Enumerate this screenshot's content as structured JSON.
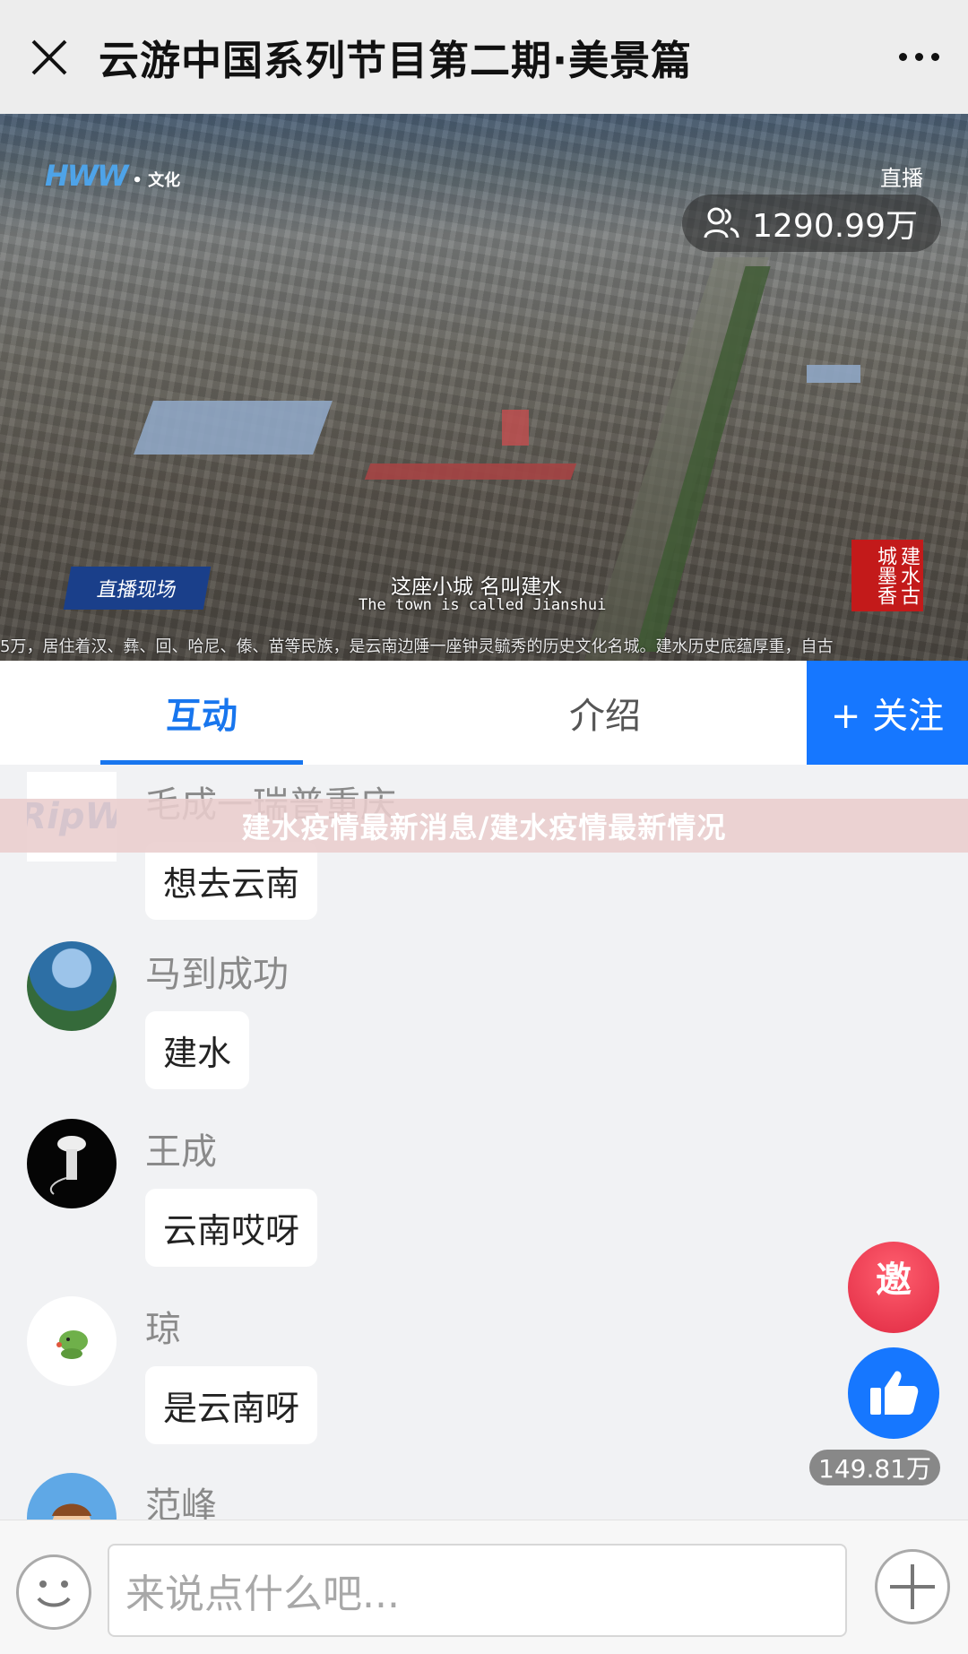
{
  "header": {
    "title": "云游中国系列节目第二期·美景篇",
    "close_icon": "close-icon",
    "more_icon": "more-dots-icon"
  },
  "video": {
    "logo_text": "HWW",
    "logo_sub": "• 文化",
    "live_label": "直播",
    "viewers": "1290.99万",
    "scene_badge": "直播现场",
    "subtitle_cn": "这座小城 名叫建水",
    "subtitle_en": "The town is called Jianshui",
    "ticker": "5万，居住着汉、彝、回、哈尼、傣、苗等民族，是云南边陲一座钟灵毓秀的历史文化名城。建水历史底蕴厚重，自古",
    "seal_text": "建水古城墨香"
  },
  "tabs": [
    {
      "label": "互动",
      "active": true
    },
    {
      "label": "介绍",
      "active": false
    }
  ],
  "follow_label": "+ 关注",
  "watermark": "建水疫情最新消息/建水疫情最新情况",
  "comments": [
    {
      "name": "毛成一瑞普重庆",
      "text": "想去云南",
      "avatar_text": "RipW"
    },
    {
      "name": "马到成功",
      "text": "建水"
    },
    {
      "name": "王成",
      "text": "云南哎呀"
    },
    {
      "name": "琼",
      "text": "是云南呀"
    },
    {
      "name": "范峰",
      "text": ""
    }
  ],
  "invite_label": "邀",
  "like_count": "149.81万",
  "input": {
    "placeholder": "来说点什么吧..."
  },
  "colors": {
    "accent": "#1677ff",
    "invite": "#e02942",
    "banner": "#e9cdcd"
  }
}
